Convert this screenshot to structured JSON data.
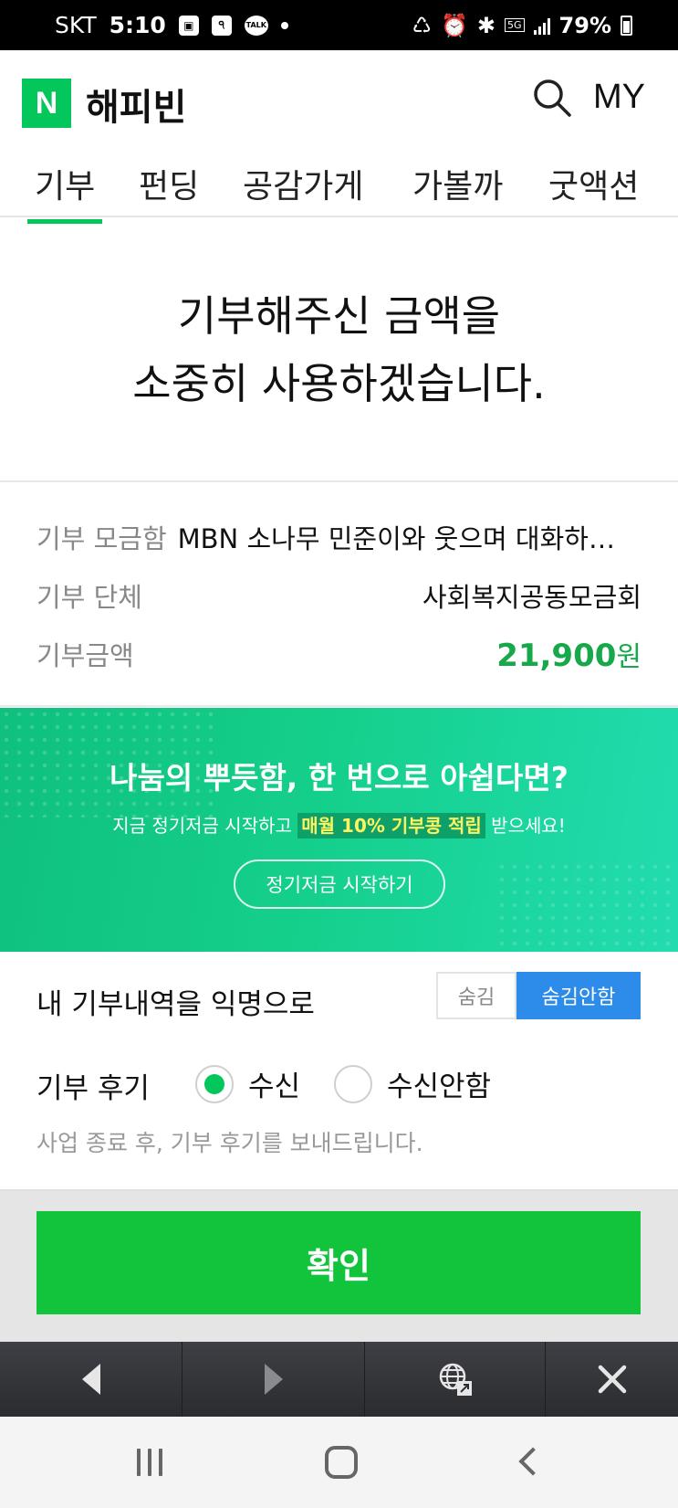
{
  "status_bar": {
    "carrier": "SKT",
    "time": "5:10",
    "network": "5G",
    "battery": "79%"
  },
  "header": {
    "logo_letter": "N",
    "brand": "해피빈",
    "my_label": "MY"
  },
  "tabs": [
    {
      "label": "기부",
      "active": true
    },
    {
      "label": "펀딩",
      "active": false
    },
    {
      "label": "공감가게",
      "active": false
    },
    {
      "label": "가볼까",
      "active": false
    },
    {
      "label": "굿액션",
      "active": false
    }
  ],
  "hero": {
    "line1": "기부해주신 금액을",
    "line2": "소중히 사용하겠습니다."
  },
  "donation_info": {
    "box_label": "기부 모금함",
    "box_value": "MBN 소나무 민준이와 웃으며 대화하…",
    "org_label": "기부 단체",
    "org_value": "사회복지공동모금회",
    "amount_label": "기부금액",
    "amount_number": "21,900",
    "amount_unit": "원"
  },
  "banner": {
    "title": "나눔의 뿌듯함, 한 번으로 아쉽다면?",
    "sub_before": "지금 정기저금 시작하고 ",
    "sub_highlight": "매월 10% 기부콩 적립",
    "sub_after": " 받으세요!",
    "button": "정기저금 시작하기"
  },
  "anonymous": {
    "label": "내 기부내역을 익명으로",
    "option_hide": "숨김",
    "option_show": "숨김안함",
    "selected": "숨김안함"
  },
  "review": {
    "label": "기부 후기",
    "option_receive": "수신",
    "option_decline": "수신안함",
    "selected": "수신",
    "note": "사업 종료 후, 기부 후기를 보내드립니다."
  },
  "confirm": {
    "label": "확인"
  },
  "colors": {
    "brand_green": "#03c75a",
    "amount_green": "#16a84a",
    "confirm_green": "#12c43c",
    "toggle_blue": "#2d8ce9",
    "banner_highlight": "#fff45e"
  }
}
